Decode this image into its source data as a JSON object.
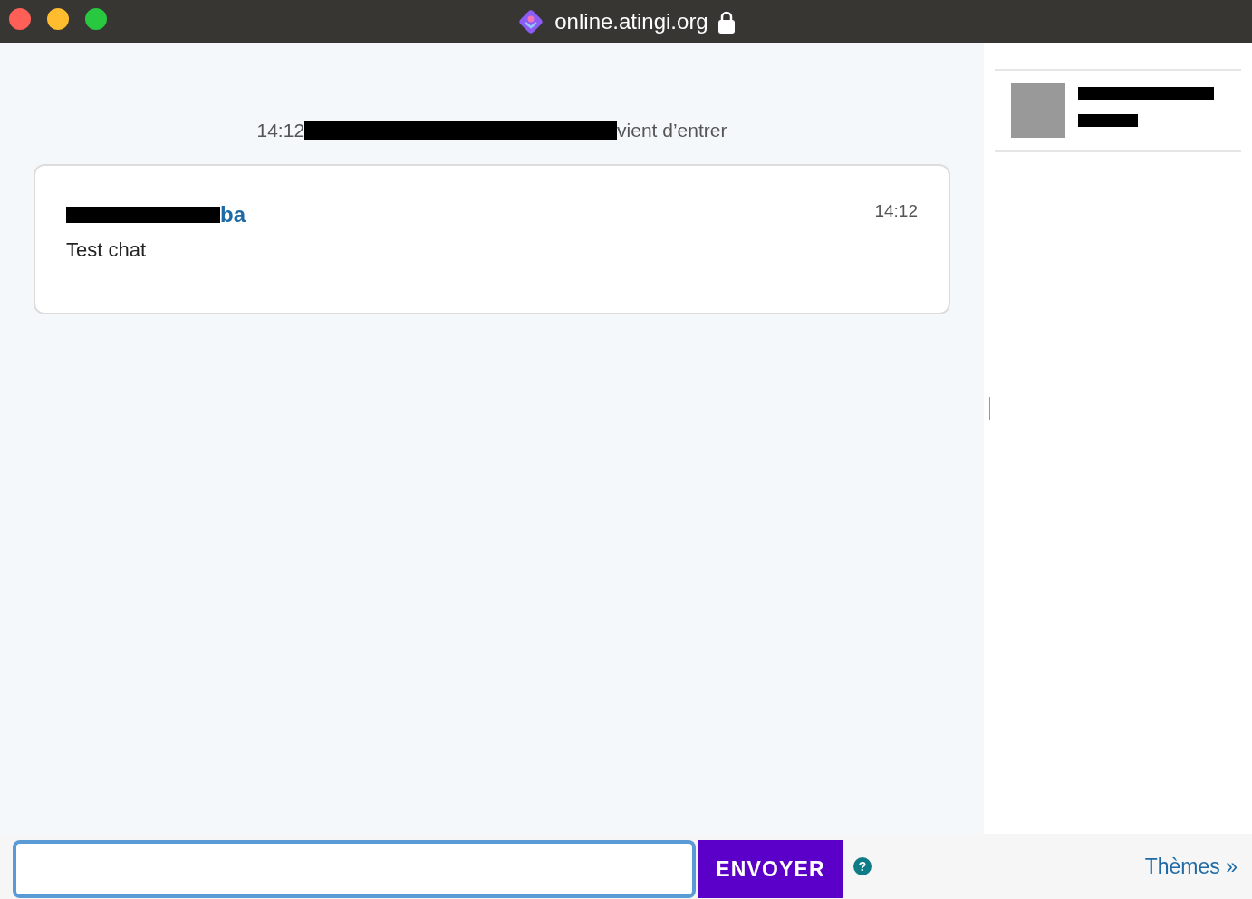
{
  "window": {
    "title": "online.atingi.org"
  },
  "event": {
    "time": "14:12",
    "text": "vient d’entrer"
  },
  "messages": [
    {
      "author": "ba",
      "time": "14:12",
      "text": "Test chat"
    }
  ],
  "users": [
    {
      "redacted": true
    }
  ],
  "composer": {
    "send": "ENVOYER",
    "help": "?",
    "themes": "Thèmes »"
  }
}
